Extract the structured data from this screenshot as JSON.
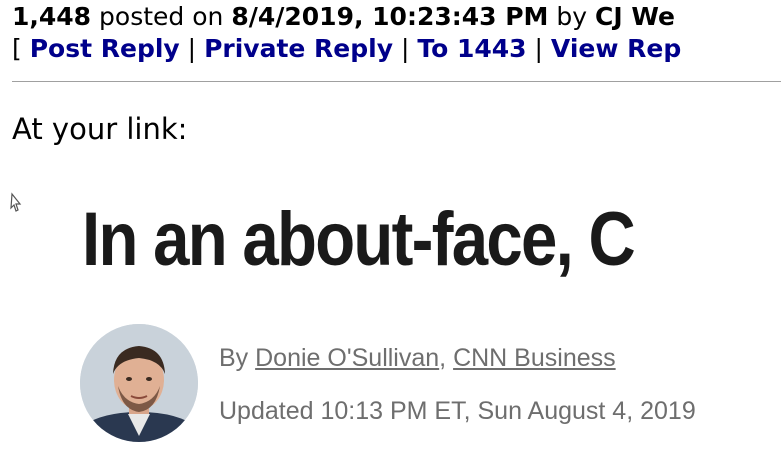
{
  "post": {
    "number": "1,448",
    "posted_on_label": "posted on",
    "date": "8/4/2019, 10:23:43 PM",
    "by_label": "by",
    "author": "CJ We"
  },
  "actions": {
    "open_bracket": "[",
    "post_reply": "Post Reply",
    "sep": "|",
    "private_reply": "Private Reply",
    "to": "To 1443",
    "view_replies": "View Rep"
  },
  "body": {
    "text": "At your link:"
  },
  "embed": {
    "headline": "In an about-face, C",
    "byline_prefix": "By ",
    "author_link": "Donie O'Sullivan",
    "byline_comma": ", ",
    "outlet_link": "CNN Business",
    "updated": "Updated 10:13 PM ET, Sun August 4, 2019"
  },
  "colors": {
    "link": "#00008b",
    "headline": "#1a1a1a",
    "byline": "#6e6e6e"
  }
}
